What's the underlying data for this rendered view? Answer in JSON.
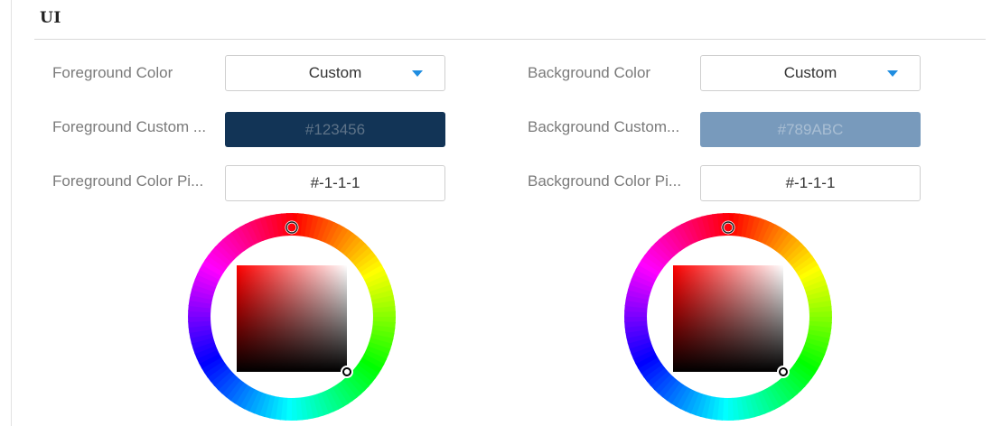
{
  "section": {
    "title": "UI"
  },
  "foreground": {
    "color_label": "Foreground Color",
    "color_value": "Custom",
    "custom_label": "Foreground Custom ...",
    "custom_value": "#123456",
    "custom_swatch": "#123456",
    "picker_label": "Foreground Color Pi...",
    "picker_value": "#-1-1-1"
  },
  "background": {
    "color_label": "Background Color",
    "color_value": "Custom",
    "custom_label": "Background Custom...",
    "custom_value": "#789ABC",
    "custom_swatch": "#789ABC",
    "picker_label": "Background Color Pi...",
    "picker_value": "#-1-1-1"
  },
  "colors": {
    "accent": "#1f8de0",
    "label_text": "#7a7a7a"
  },
  "icons": {
    "dropdown": "caret-down-icon",
    "picker": "color-wheel-icon"
  }
}
